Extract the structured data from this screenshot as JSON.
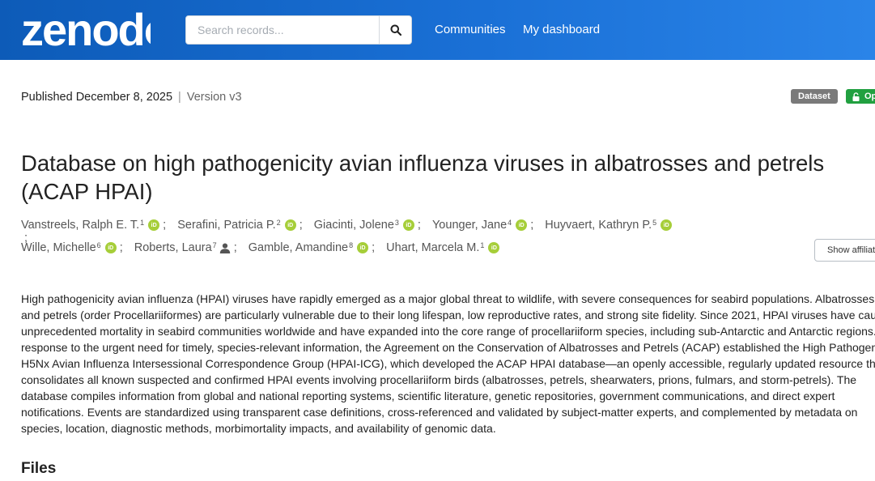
{
  "header": {
    "logo_text": "zenodo",
    "search": {
      "placeholder": "Search records..."
    },
    "nav": [
      "Communities",
      "My dashboard"
    ]
  },
  "record": {
    "published": "Published December 8, 2025",
    "separator": "|",
    "version": "Version v3",
    "badges": {
      "type": "Dataset",
      "access": "Open"
    },
    "title": "Database on high pathogenicity avian influenza viruses in albatrosses and petrels (ACAP HPAI)",
    "authors": [
      {
        "name": "Vanstreels, Ralph E. T.",
        "sup": "1",
        "icon": "orcid"
      },
      {
        "name": "Serafini, Patricia P.",
        "sup": "2",
        "icon": "orcid"
      },
      {
        "name": "Giacinti, Jolene",
        "sup": "3",
        "icon": "orcid"
      },
      {
        "name": "Younger, Jane",
        "sup": "4",
        "icon": "orcid"
      },
      {
        "name": "Huyvaert, Kathryn P.",
        "sup": "5",
        "icon": "orcid"
      },
      {
        "name": "Wille, Michelle",
        "sup": "6",
        "icon": "orcid"
      },
      {
        "name": "Roberts, Laura",
        "sup": "7",
        "icon": "person"
      },
      {
        "name": "Gamble, Amandine",
        "sup": "8",
        "icon": "orcid"
      },
      {
        "name": "Uhart, Marcela M.",
        "sup": "1",
        "icon": "orcid"
      }
    ],
    "orcid_label": "iD",
    "semicolon": ";",
    "show_affiliations": "Show affiliations",
    "description_lines": [
      "High pathogenicity avian influenza (HPAI) viruses have rapidly emerged as a major global threat to wildlife, with severe consequences for seabird populations. Albatrosses",
      "and petrels (order Procellariiformes) are particularly vulnerable due to their long lifespan, low reproductive rates, and strong site fidelity. Since 2021, HPAI viruses have caused",
      "unprecedented mortality in seabird communities worldwide and have expanded into the core range of procellariiform species, including sub-Antarctic and Antarctic regions. In",
      "response to the urgent need for timely, species-relevant information, the Agreement on the Conservation of Albatrosses and Petrels (ACAP) established the High Pathogenicity",
      "H5Nx Avian Influenza Intersessional Correspondence Group (HPAI-ICG), which developed the ACAP HPAI database—an openly accessible, regularly updated resource that",
      "consolidates all known suspected and confirmed HPAI events involving procellariiform birds (albatrosses, petrels, shearwaters, prions, fulmars, and storm-petrels). The",
      "database compiles information from global and national reporting systems, scientific literature, genetic repositories, government communications, and direct expert",
      "notifications. Events are standardized using transparent case definitions, cross-referenced and validated by subject-matter experts, and complemented by metadata on",
      "species, location, diagnostic methods, morbimortality impacts, and availability of genomic data."
    ],
    "files_heading": "Files"
  },
  "colors": {
    "header_start": "#0d5bb8",
    "header_end": "#2a84e8",
    "orcid_green": "#a6ce39",
    "open_badge": "#21a040",
    "dataset_badge": "#7a7a7a"
  }
}
